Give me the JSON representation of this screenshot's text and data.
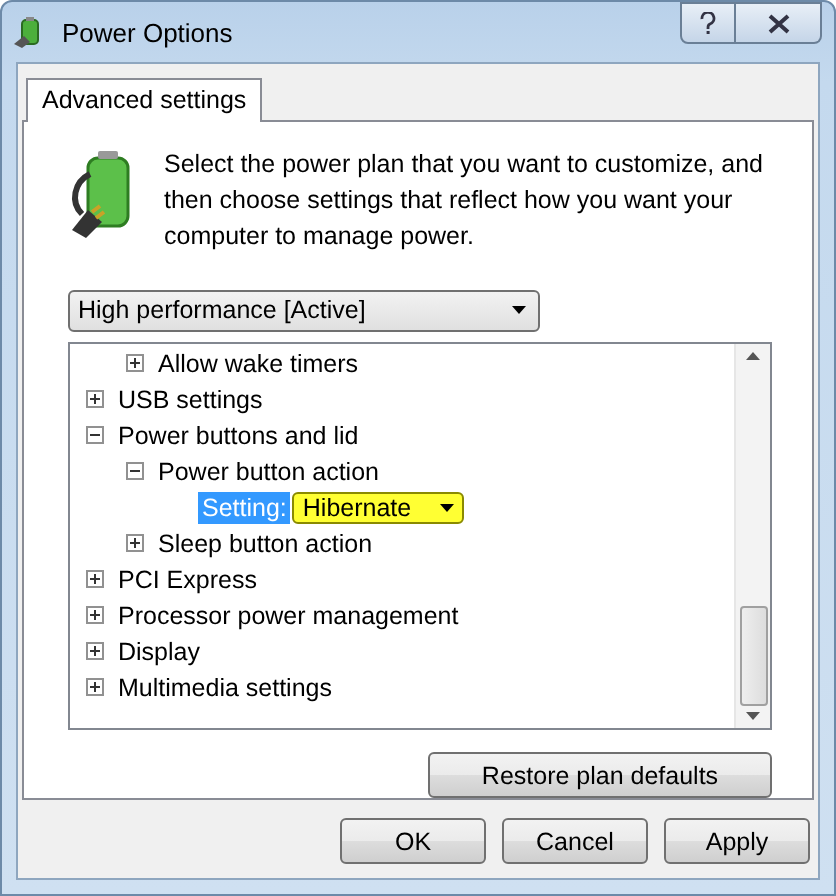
{
  "window": {
    "title": "Power Options"
  },
  "tabs": [
    {
      "label": "Advanced settings",
      "selected": true
    }
  ],
  "intro": "Select the power plan that you want to customize, and then choose settings that reflect how you want your computer to manage power.",
  "plan_dropdown": {
    "value": "High performance [Active]"
  },
  "tree": [
    {
      "children": [
        {
          "label": "Allow wake timers",
          "expanded": false
        }
      ]
    },
    {
      "label": "USB settings",
      "expanded": false
    },
    {
      "label": "Power buttons and lid",
      "expanded": true,
      "children": [
        {
          "label": "Power button action",
          "expanded": true,
          "children": [
            {
              "kind": "setting",
              "label": "Setting:",
              "value": "Hibernate",
              "selected": true
            }
          ]
        },
        {
          "label": "Sleep button action",
          "expanded": false
        }
      ]
    },
    {
      "label": "PCI Express",
      "expanded": false
    },
    {
      "label": "Processor power management",
      "expanded": false
    },
    {
      "label": "Display",
      "expanded": false
    },
    {
      "label": "Multimedia settings",
      "expanded": false
    }
  ],
  "restore_button": "Restore plan defaults",
  "buttons": [
    "OK",
    "Cancel",
    "Apply"
  ]
}
